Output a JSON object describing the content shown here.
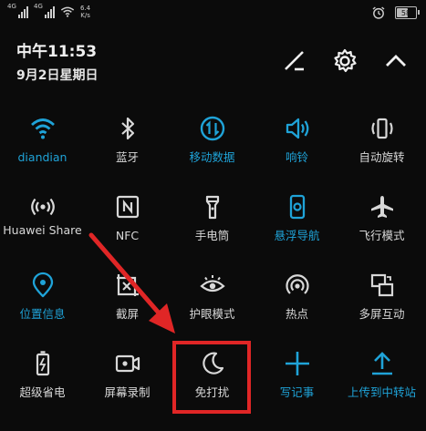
{
  "status": {
    "net_label_1": "4G",
    "net_label_2": "4G",
    "speed": "6.4",
    "speed_unit": "K/s",
    "battery": "58"
  },
  "header": {
    "time": "中午11:53",
    "date": "9月2日星期日"
  },
  "tiles": [
    {
      "label": "diandian",
      "icon": "wifi-icon",
      "on": true
    },
    {
      "label": "蓝牙",
      "icon": "bluetooth-icon",
      "on": false
    },
    {
      "label": "移动数据",
      "icon": "mobile-data-icon",
      "on": true
    },
    {
      "label": "响铃",
      "icon": "speaker-icon",
      "on": true
    },
    {
      "label": "自动旋转",
      "icon": "rotate-icon",
      "on": false
    },
    {
      "label": "Huawei Share",
      "icon": "huawei-share-icon",
      "on": false
    },
    {
      "label": "NFC",
      "icon": "nfc-icon",
      "on": false
    },
    {
      "label": "手电筒",
      "icon": "flashlight-icon",
      "on": false
    },
    {
      "label": "悬浮导航",
      "icon": "floating-nav-icon",
      "on": true
    },
    {
      "label": "飞行模式",
      "icon": "airplane-icon",
      "on": false
    },
    {
      "label": "位置信息",
      "icon": "location-icon",
      "on": true
    },
    {
      "label": "截屏",
      "icon": "screenshot-icon",
      "on": false
    },
    {
      "label": "护眼模式",
      "icon": "eye-icon",
      "on": false
    },
    {
      "label": "热点",
      "icon": "hotspot-icon",
      "on": false
    },
    {
      "label": "多屏互动",
      "icon": "multi-screen-icon",
      "on": false
    },
    {
      "label": "超级省电",
      "icon": "battery-saver-icon",
      "on": false
    },
    {
      "label": "屏幕录制",
      "icon": "screen-record-icon",
      "on": false
    },
    {
      "label": "免打扰",
      "icon": "moon-icon",
      "on": false
    },
    {
      "label": "写记事",
      "icon": "plus-icon",
      "on": true
    },
    {
      "label": "上传到中转站",
      "icon": "upload-icon",
      "on": true
    }
  ],
  "colors": {
    "accent": "#1fa3d8",
    "inactive": "#d8d8d8",
    "highlight": "#e02626"
  }
}
